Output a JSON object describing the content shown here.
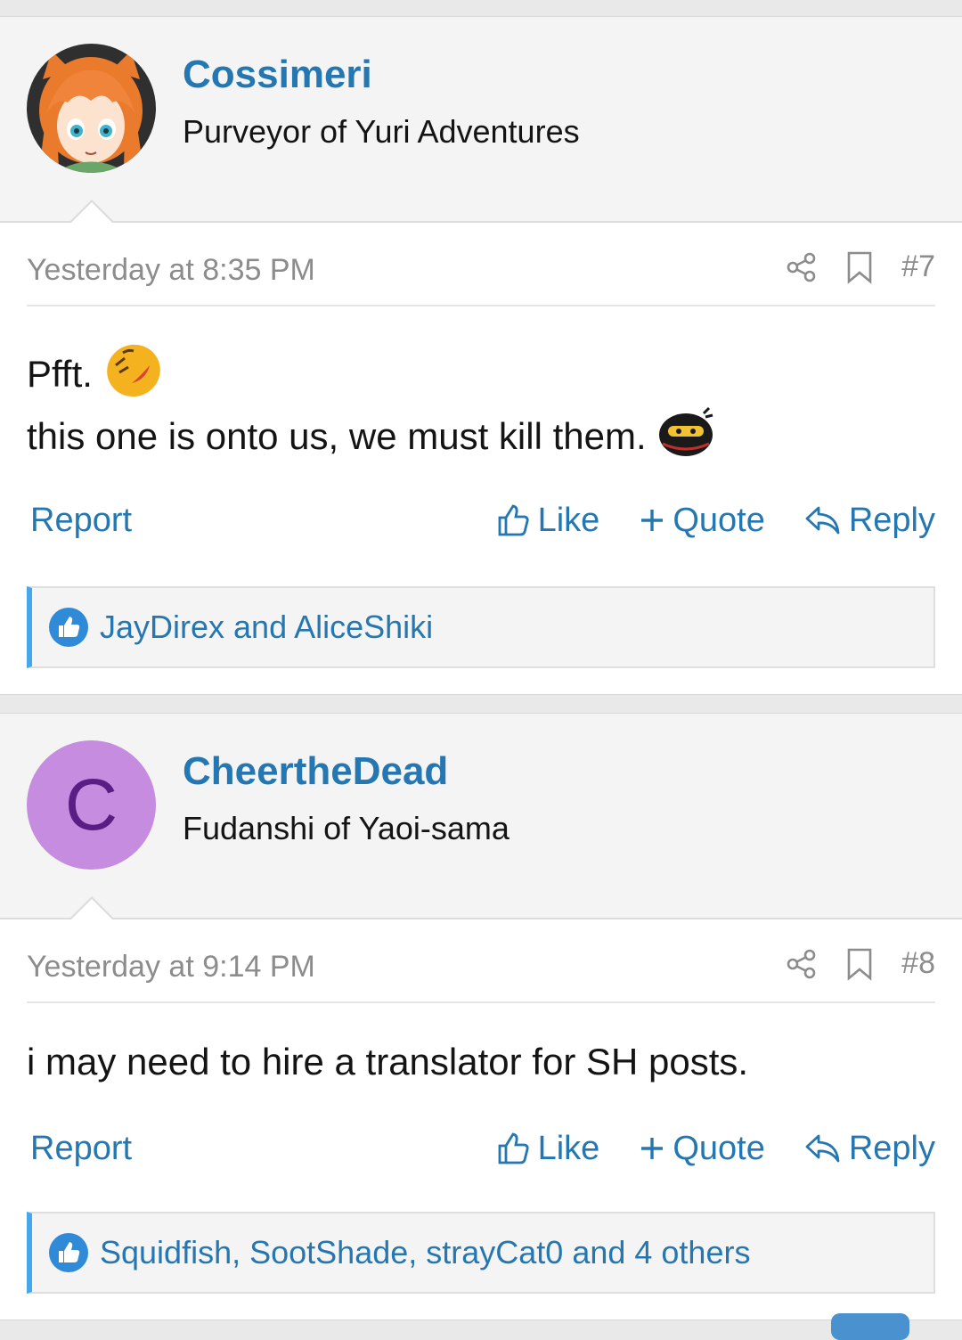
{
  "posts": [
    {
      "username": "Cossimeri",
      "user_title": "Purveyor of Yuri Adventures",
      "avatar": "anime-girl-avatar",
      "date": "Yesterday at 8:35 PM",
      "post_number": "#7",
      "lines": [
        "Pfft.",
        "this one is onto us, we must kill them."
      ],
      "line_emojis": [
        "laughing-emoji",
        "ninja-emoji"
      ],
      "report_label": "Report",
      "like_label": "Like",
      "quote_label": "Quote",
      "reply_label": "Reply",
      "reactions_text": "JayDirex and AliceShiki"
    },
    {
      "username": "CheertheDead",
      "user_title": "Fudanshi of Yaoi-sama",
      "avatar_letter": "C",
      "date": "Yesterday at 9:14 PM",
      "post_number": "#8",
      "lines": [
        "i may need to hire a translator for SH posts."
      ],
      "report_label": "Report",
      "like_label": "Like",
      "quote_label": "Quote",
      "reply_label": "Reply",
      "reactions_text": "Squidfish, SootShade, strayCat0 and 4 others"
    }
  ],
  "icons": {
    "share": "share-icon",
    "bookmark": "bookmark-icon",
    "like": "thumbs-up-icon",
    "quote": "plus-icon",
    "reply": "reply-icon",
    "reaction": "like-reaction-icon"
  },
  "colors": {
    "link": "#2577b1",
    "reaction_accent": "#47a7eb",
    "avatar_letter_bg": "#c58ce0",
    "avatar_letter_fg": "#5a1d83"
  }
}
